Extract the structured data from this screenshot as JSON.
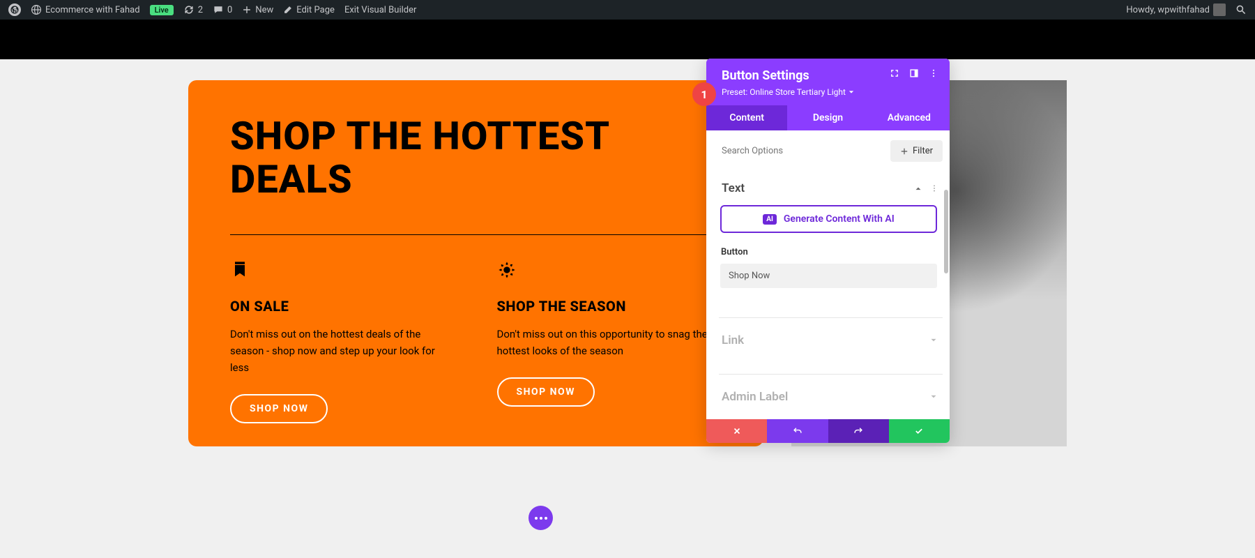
{
  "adminBar": {
    "siteName": "Ecommerce with Fahad",
    "liveBadge": "Live",
    "updates": "2",
    "comments": "0",
    "newLabel": "New",
    "editPage": "Edit Page",
    "exitBuilder": "Exit Visual Builder",
    "greeting": "Howdy, wpwithfahad"
  },
  "hero": {
    "title": "SHOP THE HOTTEST DEALS",
    "features": [
      {
        "title": "ON SALE",
        "text": "Don't miss out on the hottest deals of the season - shop now and step up your look for less",
        "btn": "SHOP NOW"
      },
      {
        "title": "SHOP THE SEASON",
        "text": "Don't miss out on this opportunity to snag the hottest looks of the season",
        "btn": "SHOP NOW"
      }
    ]
  },
  "panel": {
    "title": "Button Settings",
    "preset": "Preset: Online Store Tertiary Light",
    "tabs": {
      "content": "Content",
      "design": "Design",
      "advanced": "Advanced"
    },
    "searchPlaceholder": "Search Options",
    "filterLabel": "Filter",
    "sections": {
      "text": "Text",
      "link": "Link",
      "adminLabel": "Admin Label"
    },
    "aiBtn": "Generate Content With AI",
    "aiBadge": "AI",
    "buttonField": {
      "label": "Button",
      "value": "Shop Now"
    },
    "badgeNumber": "1"
  }
}
